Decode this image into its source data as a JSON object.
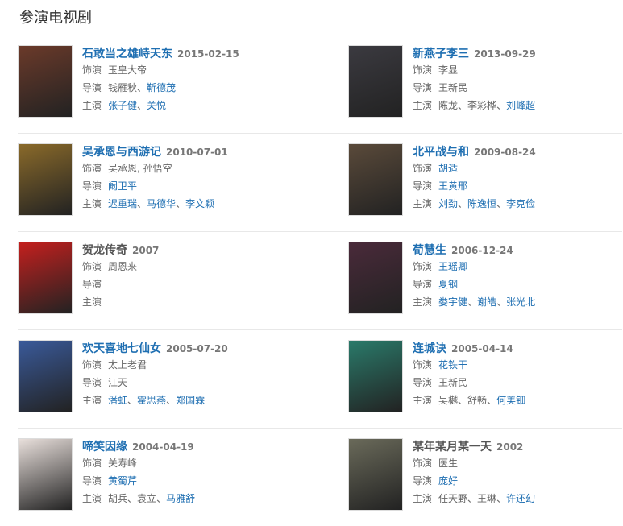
{
  "section_title": "参演电视剧",
  "labels": {
    "role": "饰演",
    "director": "导演",
    "lead": "主演"
  },
  "items": [
    {
      "title": "石敢当之雄峙天东",
      "date": "2015-02-15",
      "role": "玉皇大帝",
      "role_link": false,
      "directors": [
        {
          "t": "钱雁秋",
          "link": false
        },
        {
          "t": "、",
          "link": false
        },
        {
          "t": "靳德茂",
          "link": true
        }
      ],
      "leads": [
        {
          "t": "张子健",
          "link": true
        },
        {
          "t": "、",
          "link": false
        },
        {
          "t": "关悦",
          "link": true
        }
      ],
      "poster_color": "#6b3a2a"
    },
    {
      "title": "新燕子李三",
      "date": "2013-09-29",
      "role": "李显",
      "role_link": false,
      "directors": [
        {
          "t": "王新民",
          "link": false
        }
      ],
      "leads": [
        {
          "t": "陈龙",
          "link": false
        },
        {
          "t": "、",
          "link": false
        },
        {
          "t": "李彩桦",
          "link": false
        },
        {
          "t": "、",
          "link": false
        },
        {
          "t": "刘峰超",
          "link": true
        }
      ],
      "poster_color": "#3b3a40"
    },
    {
      "title": "吴承恩与西游记",
      "date": "2010-07-01",
      "role": "吴承恩, 孙悟空",
      "role_link": false,
      "directors": [
        {
          "t": "阚卫平",
          "link": true
        }
      ],
      "leads": [
        {
          "t": "迟重瑞",
          "link": true
        },
        {
          "t": "、",
          "link": false
        },
        {
          "t": "马德华",
          "link": true
        },
        {
          "t": "、",
          "link": false
        },
        {
          "t": "李文颖",
          "link": true
        }
      ],
      "poster_color": "#8a6a2a"
    },
    {
      "title": "北平战与和",
      "date": "2009-08-24",
      "role": "胡适",
      "role_link": true,
      "directors": [
        {
          "t": "王黄邢",
          "link": true
        }
      ],
      "leads": [
        {
          "t": "刘劲",
          "link": true
        },
        {
          "t": "、",
          "link": false
        },
        {
          "t": "陈逸恒",
          "link": true
        },
        {
          "t": "、",
          "link": false
        },
        {
          "t": "李克俭",
          "link": true
        }
      ],
      "poster_color": "#5a4a3a"
    },
    {
      "title": "贺龙传奇",
      "date": "2007",
      "role": "周恩来",
      "role_link": false,
      "title_plain": true,
      "directors": [],
      "leads": [],
      "poster_color": "#c4201e"
    },
    {
      "title": "荀慧生",
      "date": "2006-12-24",
      "role": "王瑶卿",
      "role_link": true,
      "directors": [
        {
          "t": "夏钢",
          "link": true
        }
      ],
      "leads": [
        {
          "t": "娄宇健",
          "link": true
        },
        {
          "t": "、",
          "link": false
        },
        {
          "t": "谢皓",
          "link": true
        },
        {
          "t": "、",
          "link": false
        },
        {
          "t": "张光北",
          "link": true
        }
      ],
      "poster_color": "#4a2a3a"
    },
    {
      "title": "欢天喜地七仙女",
      "date": "2005-07-20",
      "role": "太上老君",
      "role_link": false,
      "directors": [
        {
          "t": "江天",
          "link": false
        }
      ],
      "leads": [
        {
          "t": "潘虹",
          "link": true
        },
        {
          "t": "、",
          "link": false
        },
        {
          "t": "霍思燕",
          "link": true
        },
        {
          "t": "、",
          "link": false
        },
        {
          "t": "郑国霖",
          "link": true
        }
      ],
      "poster_color": "#3a5a9a"
    },
    {
      "title": "连城诀",
      "date": "2005-04-14",
      "role": "花铁干",
      "role_link": true,
      "directors": [
        {
          "t": "王新民",
          "link": false
        }
      ],
      "leads": [
        {
          "t": "吴樾",
          "link": false
        },
        {
          "t": "、",
          "link": false
        },
        {
          "t": "舒畅",
          "link": false
        },
        {
          "t": "、",
          "link": false
        },
        {
          "t": "何美钿",
          "link": true
        }
      ],
      "poster_color": "#2a7a6a"
    },
    {
      "title": "啼笑因缘",
      "date": "2004-04-19",
      "role": "关寿峰",
      "role_link": false,
      "directors": [
        {
          "t": "黄蜀芹",
          "link": true
        }
      ],
      "leads": [
        {
          "t": "胡兵",
          "link": false
        },
        {
          "t": "、",
          "link": false
        },
        {
          "t": "袁立",
          "link": false
        },
        {
          "t": "、",
          "link": false
        },
        {
          "t": "马雅舒",
          "link": true
        }
      ],
      "poster_color": "#e9e0dc"
    },
    {
      "title": "某年某月某一天",
      "date": "2002",
      "role": "医生",
      "role_link": false,
      "title_plain": true,
      "directors": [
        {
          "t": "庞好",
          "link": true
        }
      ],
      "leads": [
        {
          "t": "任天野",
          "link": false
        },
        {
          "t": "、",
          "link": false
        },
        {
          "t": "王琳",
          "link": false
        },
        {
          "t": "、",
          "link": false
        },
        {
          "t": "许还幻",
          "link": true
        }
      ],
      "poster_color": "#6a6a5a"
    }
  ]
}
